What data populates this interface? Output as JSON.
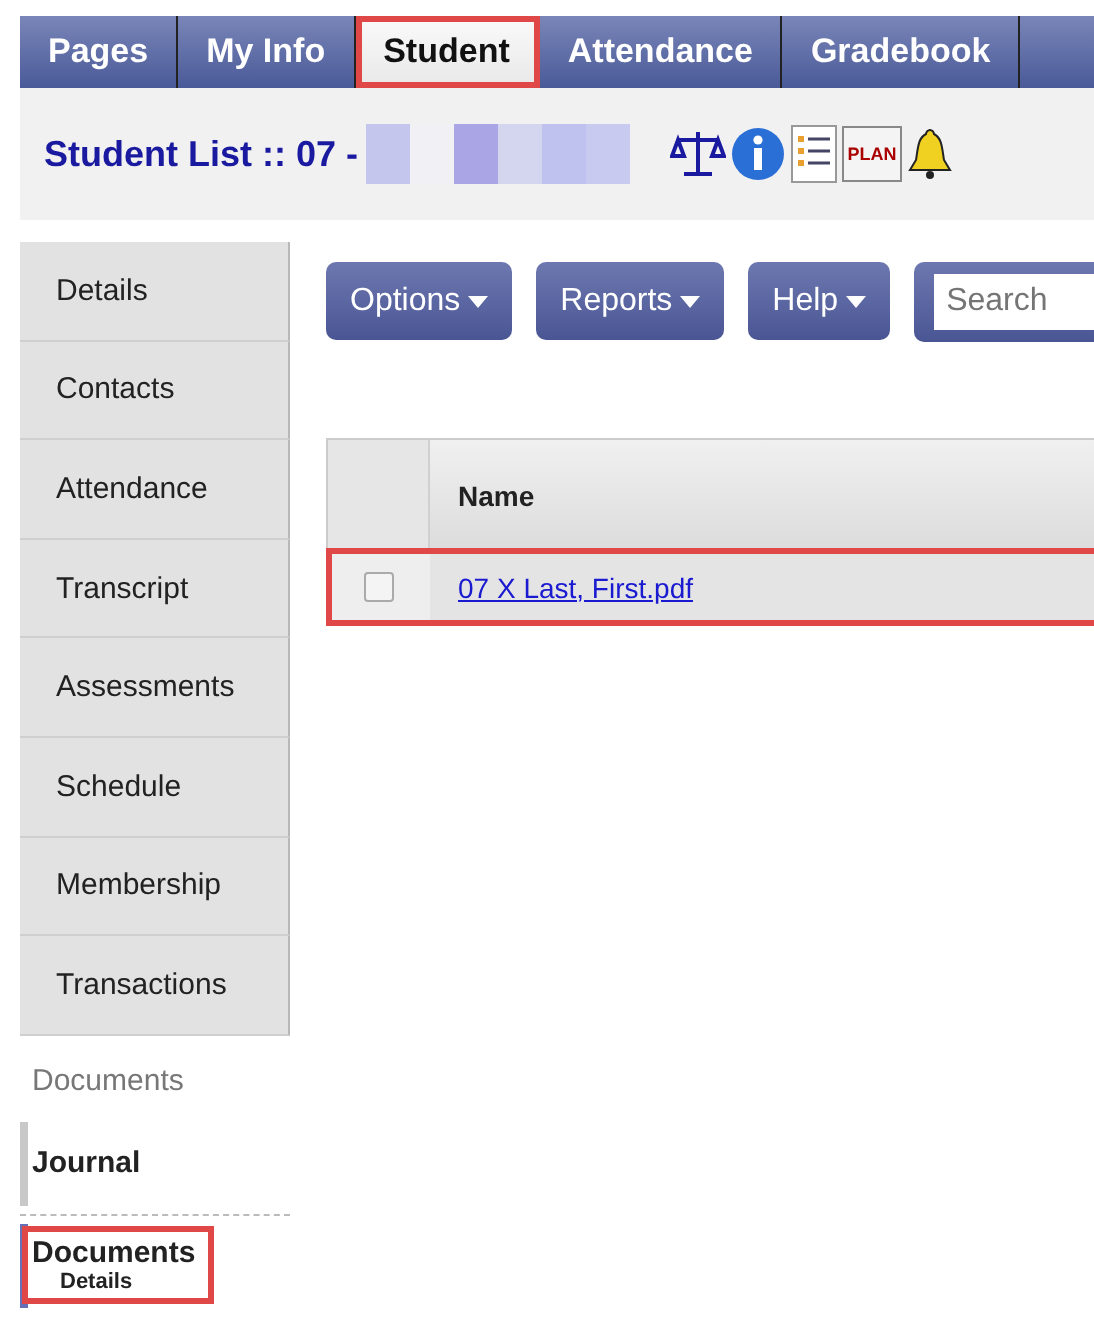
{
  "tabs": [
    {
      "label": "Pages",
      "selected": false,
      "highlighted": false
    },
    {
      "label": "My Info",
      "selected": false,
      "highlighted": false
    },
    {
      "label": "Student",
      "selected": true,
      "highlighted": true
    },
    {
      "label": "Attendance",
      "selected": false,
      "highlighted": false
    },
    {
      "label": "Gradebook",
      "selected": false,
      "highlighted": false
    }
  ],
  "header": {
    "title": "Student List :: 07 -",
    "name_redacted": true,
    "plan_icon_text": "PLAN"
  },
  "sidebar": {
    "items": [
      {
        "label": "Details"
      },
      {
        "label": "Contacts"
      },
      {
        "label": "Attendance"
      },
      {
        "label": "Transcript"
      },
      {
        "label": "Assessments"
      },
      {
        "label": "Schedule"
      },
      {
        "label": "Membership"
      },
      {
        "label": "Transactions"
      }
    ],
    "section": "Documents",
    "subitems": [
      {
        "label": "Journal",
        "selected": false,
        "highlighted": false
      },
      {
        "label": "Documents",
        "sublabel": "Details",
        "selected": true,
        "highlighted": true
      }
    ]
  },
  "toolbar": {
    "buttons": [
      "Options",
      "Reports",
      "Help"
    ],
    "search": {
      "placeholder": "Search"
    }
  },
  "table": {
    "columns": [
      "Name"
    ],
    "rows": [
      {
        "name": "07 X Last, First.pdf",
        "checked": false,
        "highlighted": true
      }
    ]
  }
}
